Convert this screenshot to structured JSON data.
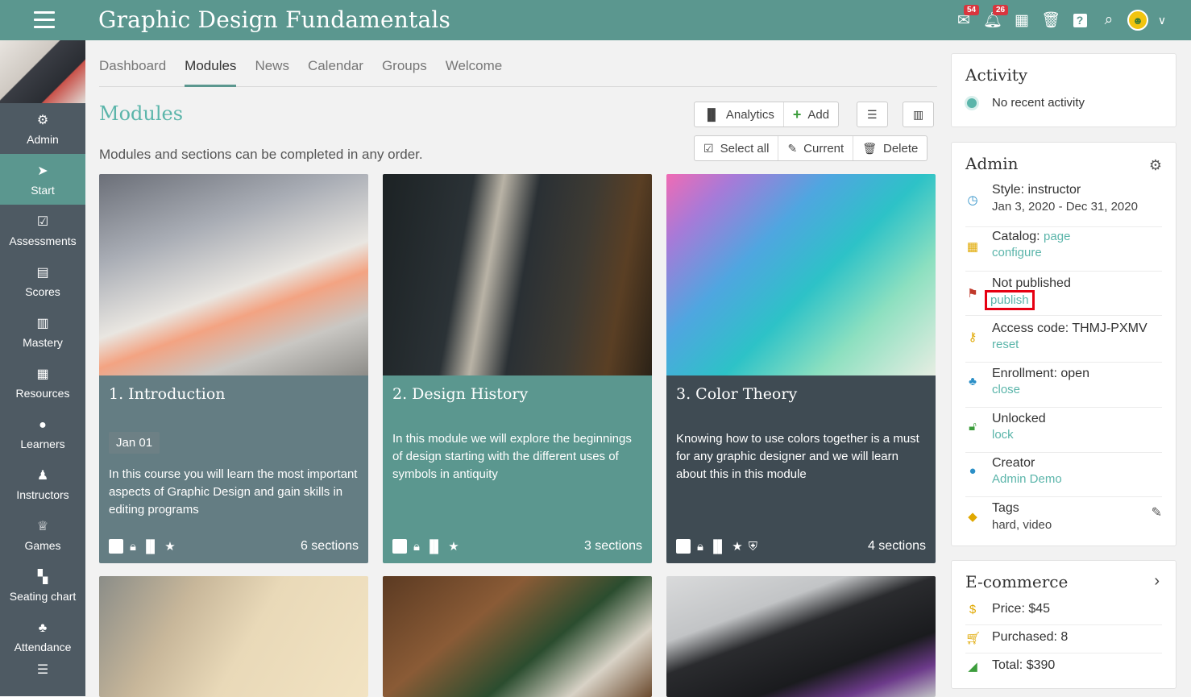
{
  "app": {
    "title": "Graphic Design Fundamentals",
    "messages_badge": "54",
    "notifications_badge": "26"
  },
  "sidebar": {
    "items": [
      {
        "label": "Admin",
        "icon": "gear-icon"
      },
      {
        "label": "Start",
        "icon": "send-icon"
      },
      {
        "label": "Assessments",
        "icon": "checkbox-icon"
      },
      {
        "label": "Scores",
        "icon": "table-icon"
      },
      {
        "label": "Mastery",
        "icon": "bar-chart-icon"
      },
      {
        "label": "Resources",
        "icon": "books-icon"
      },
      {
        "label": "Learners",
        "icon": "user-icon"
      },
      {
        "label": "Instructors",
        "icon": "instructor-icon"
      },
      {
        "label": "Games",
        "icon": "trophy-icon"
      },
      {
        "label": "Seating chart",
        "icon": "seating-icon"
      },
      {
        "label": "Attendance",
        "icon": "group-icon"
      }
    ]
  },
  "tabs": [
    "Dashboard",
    "Modules",
    "News",
    "Calendar",
    "Groups",
    "Welcome"
  ],
  "main": {
    "title": "Modules",
    "subtitle": "Modules and sections can be completed in any order.",
    "analytics_label": "Analytics",
    "add_label": "Add",
    "select_all_label": "Select all",
    "current_label": "Current",
    "delete_label": "Delete"
  },
  "cards": [
    {
      "title": "1. Introduction",
      "date": "Jan 01",
      "description": "In this course you will learn the most important aspects of Graphic Design and gain skills in editing programs",
      "sections": "6 sections",
      "color": "#647d83"
    },
    {
      "title": "2. Design History",
      "description": "In this module we will explore the beginnings of design starting with the different uses of symbols in antiquity",
      "sections": "3 sections",
      "color": "#5b978f"
    },
    {
      "title": "3. Color Theory",
      "description": "Knowing how to use colors together is a must for any graphic designer and we will learn about this in this module",
      "sections": "4 sections",
      "color": "#3f4b53"
    }
  ],
  "activity": {
    "title": "Activity",
    "empty": "No recent activity"
  },
  "admin": {
    "title": "Admin",
    "style": "Style: instructor",
    "dates": "Jan 3, 2020 - Dec 31, 2020",
    "catalog_prefix": "Catalog:",
    "catalog_link": "page",
    "catalog_configure": "configure",
    "published_status": "Not published",
    "publish_link": "publish",
    "access_code": "Access code: THMJ-PXMV",
    "access_reset": "reset",
    "enrollment": "Enrollment: open",
    "enrollment_close": "close",
    "lock_status": "Unlocked",
    "lock_link": "lock",
    "creator_label": "Creator",
    "creator_name": "Admin Demo",
    "tags_label": "Tags",
    "tags_value": "hard, video"
  },
  "ecommerce": {
    "title": "E-commerce",
    "price": "Price: $45",
    "purchased": "Purchased: 8",
    "total": "Total: $390"
  }
}
